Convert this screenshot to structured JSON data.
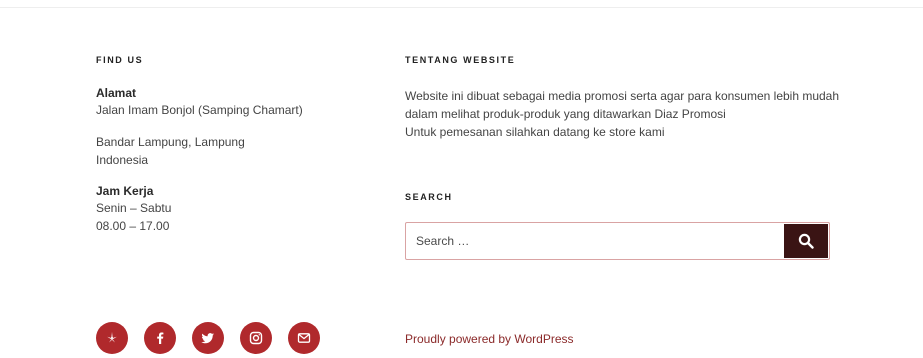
{
  "find_us": {
    "title": "FIND US",
    "address_label": "Alamat",
    "address_line1": "Jalan Imam Bonjol (Samping Chamart)",
    "address_line2": "Bandar Lampung, Lampung",
    "address_line3": "Indonesia",
    "hours_label": "Jam Kerja",
    "hours_days": "Senin – Sabtu",
    "hours_time": "08.00 – 17.00"
  },
  "about": {
    "title": "TENTANG WEBSITE",
    "line1": "Website ini dibuat sebagai media promosi serta agar para konsumen lebih mudah",
    "line2": "dalam melihat produk-produk yang ditawarkan Diaz Promosi",
    "line3": "Untuk pemesanan silahkan datang ke store kami"
  },
  "search": {
    "title": "SEARCH",
    "placeholder": "Search …"
  },
  "social": {
    "icons": [
      "yelp-icon",
      "facebook-icon",
      "twitter-icon",
      "instagram-icon",
      "email-icon"
    ],
    "color": "#b0292c"
  },
  "footer": {
    "powered_by": "Proudly powered by WordPress"
  },
  "colors": {
    "accent": "#b0292c",
    "search_button": "#3a1414",
    "link": "#8b2a2a"
  }
}
